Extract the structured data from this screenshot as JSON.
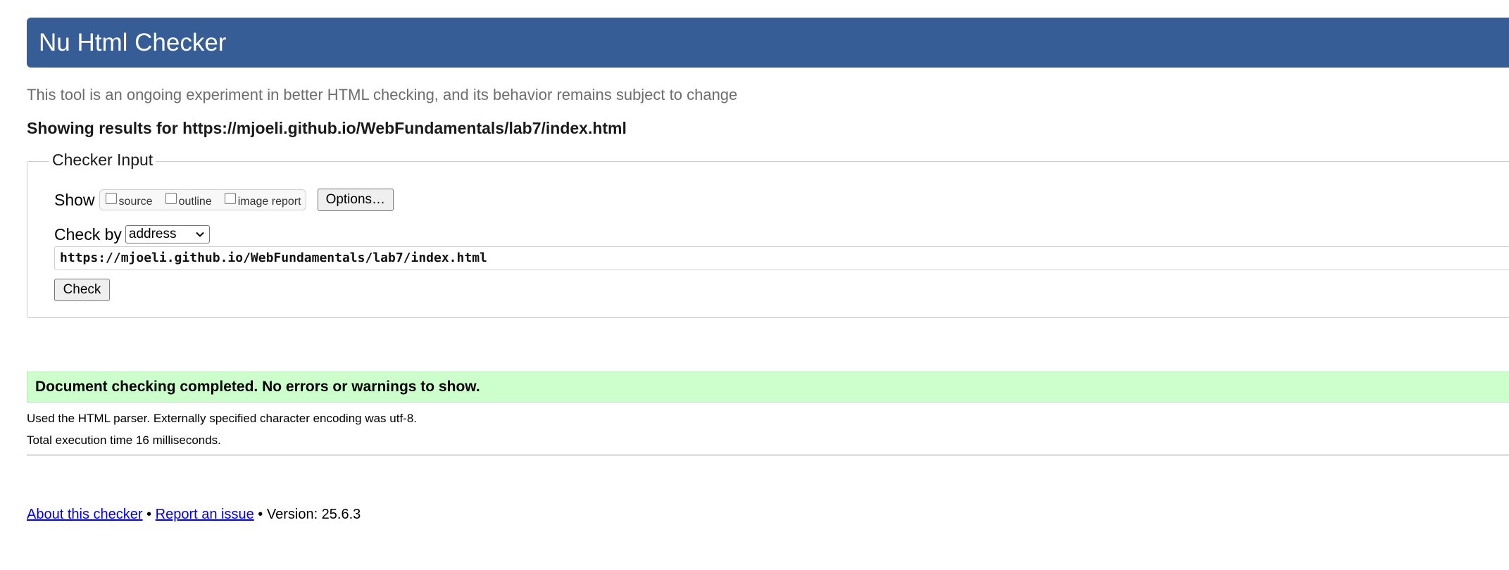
{
  "colors": {
    "brand": "#365d95",
    "success": "#ccffcc",
    "link": "#0000ee"
  },
  "header": {
    "title": "Nu Html Checker"
  },
  "subtitle": "This tool is an ongoing experiment in better HTML checking, and its behavior remains subject to change",
  "results_for": "Showing results for https://mjoeli.github.io/WebFundamentals/lab7/index.html",
  "checker_input": {
    "legend": "Checker Input",
    "show_label": "Show",
    "checkboxes": [
      {
        "label": "source",
        "checked": false
      },
      {
        "label": "outline",
        "checked": false
      },
      {
        "label": "image report",
        "checked": false
      }
    ],
    "options_label": "Options…",
    "check_by_label": "Check by",
    "check_by_selected": "address",
    "url_value": "https://mjoeli.github.io/WebFundamentals/lab7/index.html",
    "check_label": "Check"
  },
  "result": {
    "message": "Document checking completed. No errors or warnings to show.",
    "parser_info": "Used the HTML parser. Externally specified character encoding was utf-8.",
    "execution_time": "Total execution time 16 milliseconds."
  },
  "footer": {
    "about_link": "About this checker",
    "separator": " • ",
    "report_link": "Report an issue",
    "version": "Version: 25.6.3"
  },
  "icons": {
    "select_arrow": "chevron-down-icon"
  }
}
